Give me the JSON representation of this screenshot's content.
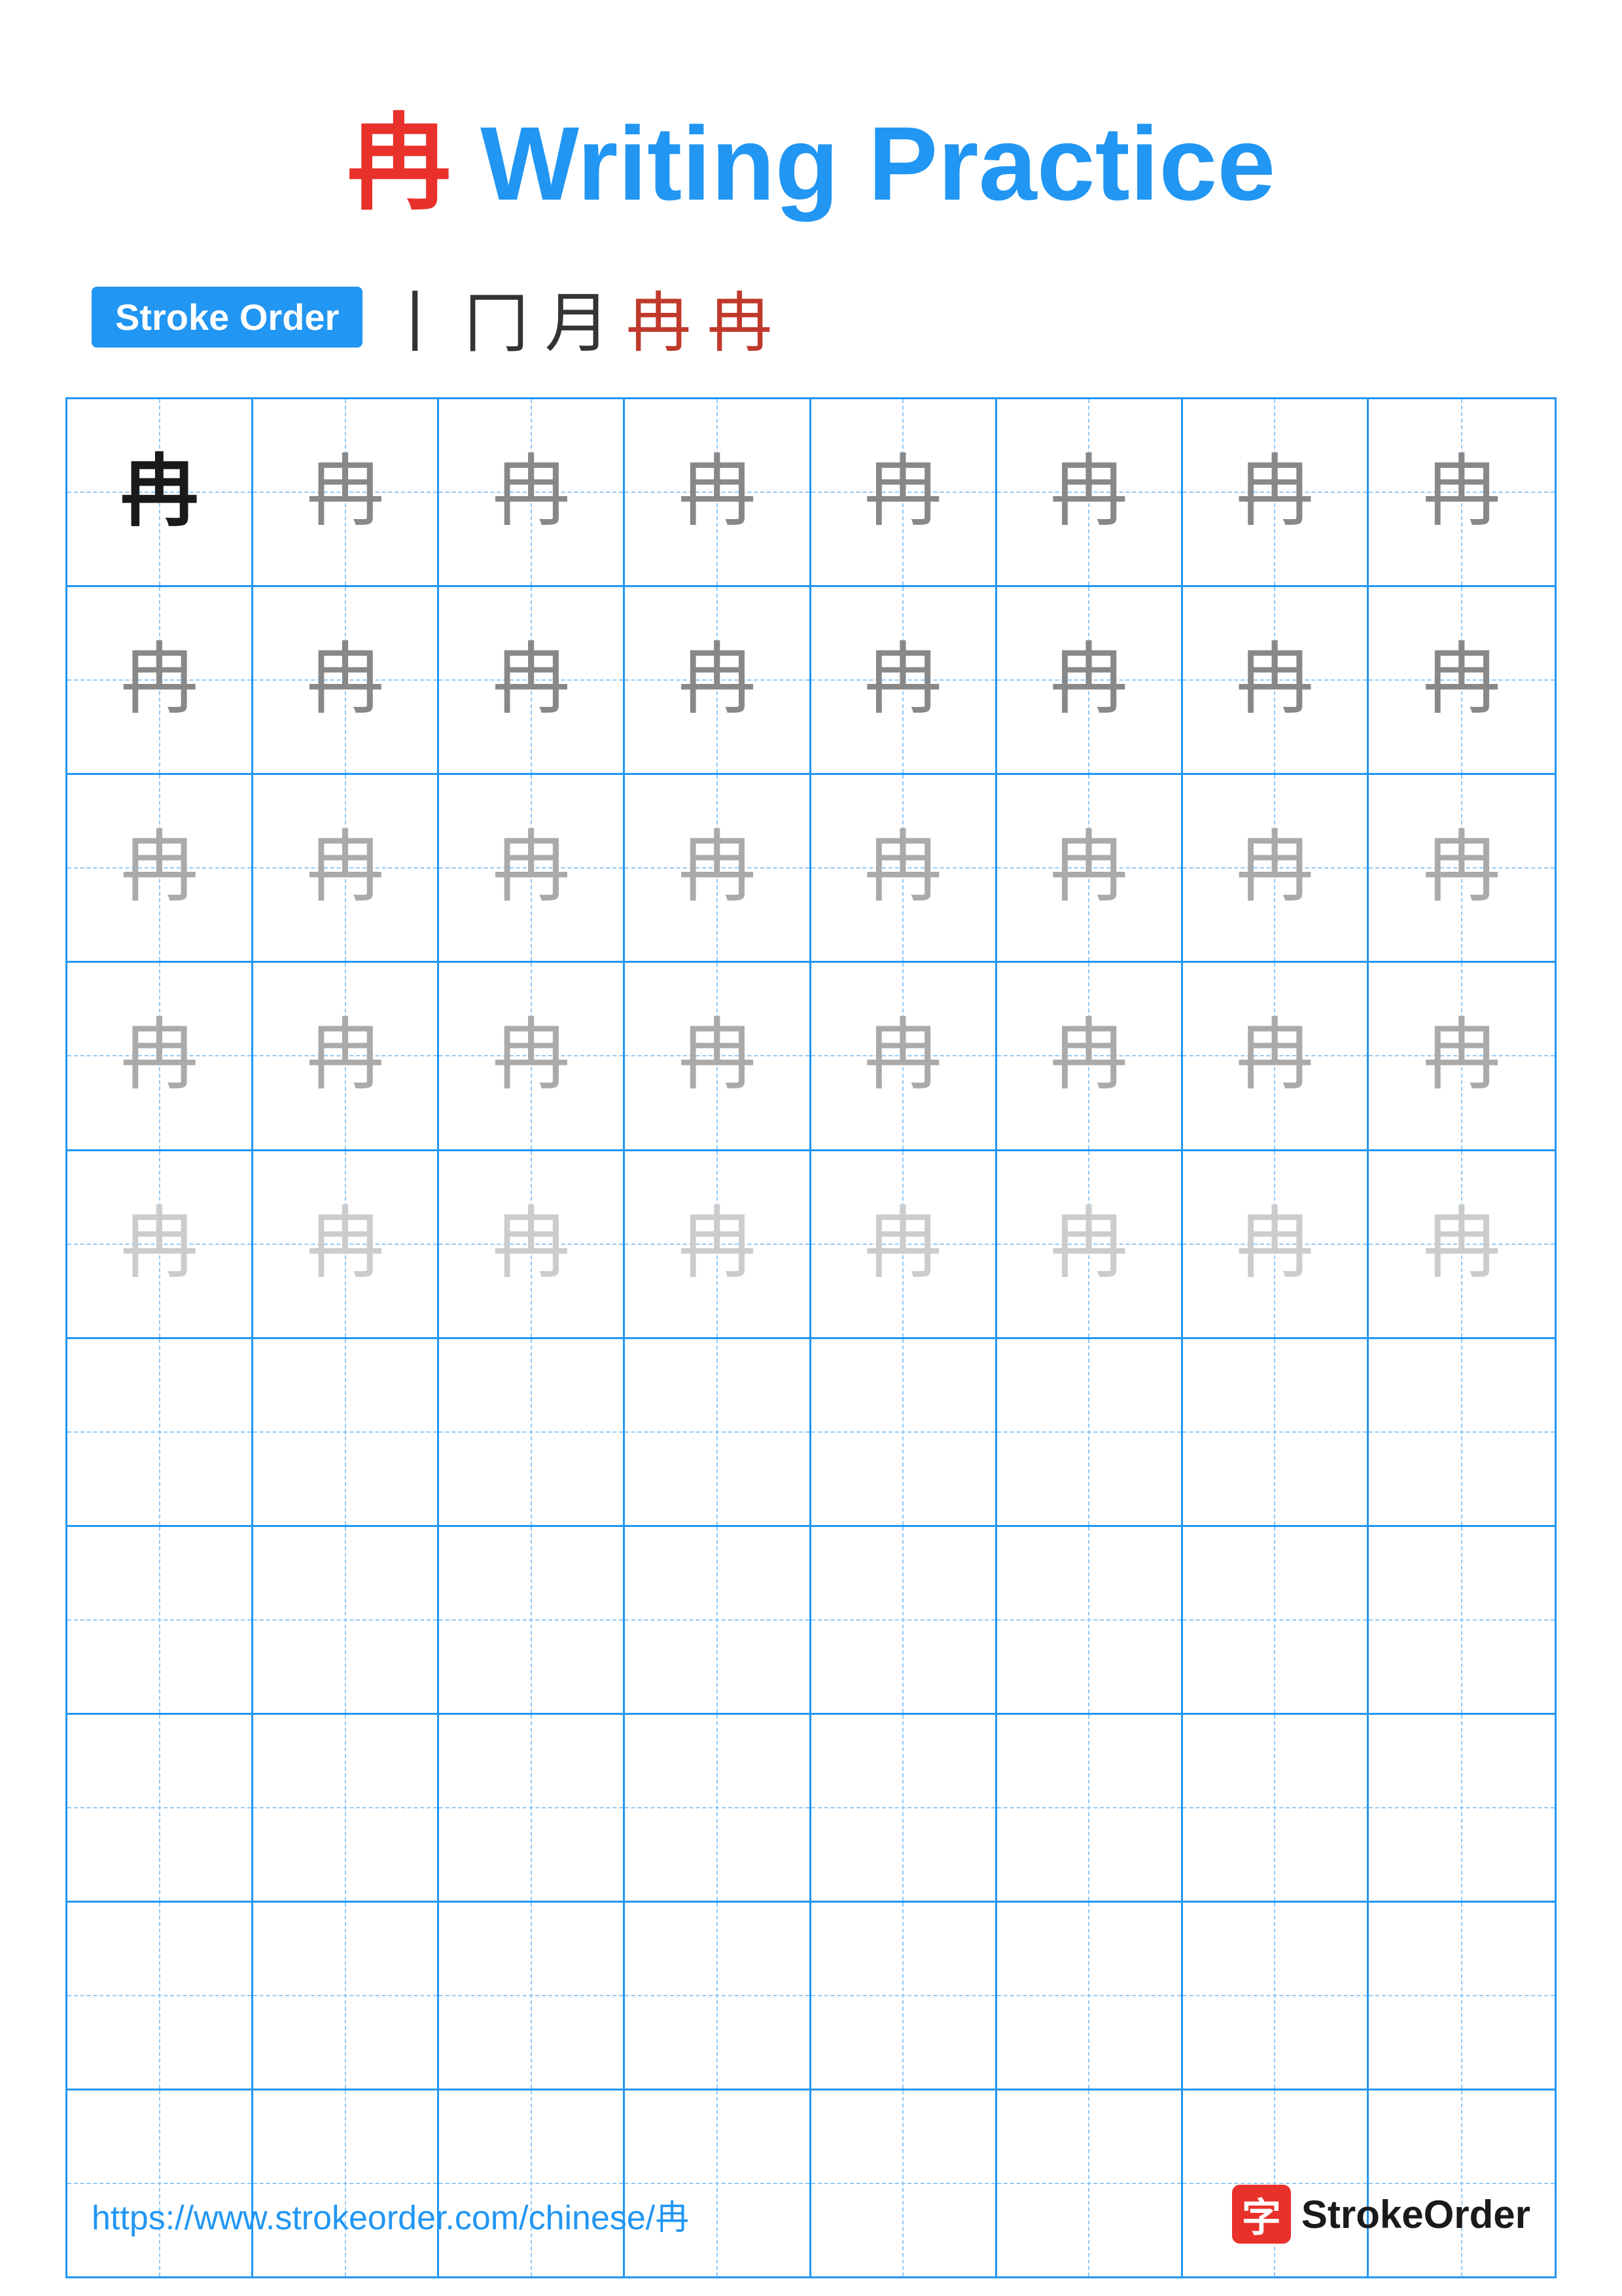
{
  "title": {
    "char": "冉",
    "text": " Writing Practice"
  },
  "stroke_order": {
    "badge_label": "Stroke Order",
    "sequence": [
      "丨",
      "冂",
      "月",
      "冉",
      "冉"
    ]
  },
  "grid": {
    "rows": 10,
    "cols": 8,
    "character": "冉",
    "row_configs": [
      {
        "chars": [
          "black",
          "dark",
          "dark",
          "dark",
          "dark",
          "dark",
          "dark",
          "dark"
        ]
      },
      {
        "chars": [
          "dark",
          "dark",
          "dark",
          "dark",
          "dark",
          "dark",
          "dark",
          "dark"
        ]
      },
      {
        "chars": [
          "medium",
          "medium",
          "medium",
          "medium",
          "medium",
          "medium",
          "medium",
          "medium"
        ]
      },
      {
        "chars": [
          "medium",
          "medium",
          "medium",
          "medium",
          "medium",
          "medium",
          "medium",
          "medium"
        ]
      },
      {
        "chars": [
          "light",
          "light",
          "light",
          "light",
          "light",
          "light",
          "light",
          "light"
        ]
      },
      {
        "chars": [
          "empty",
          "empty",
          "empty",
          "empty",
          "empty",
          "empty",
          "empty",
          "empty"
        ]
      },
      {
        "chars": [
          "empty",
          "empty",
          "empty",
          "empty",
          "empty",
          "empty",
          "empty",
          "empty"
        ]
      },
      {
        "chars": [
          "empty",
          "empty",
          "empty",
          "empty",
          "empty",
          "empty",
          "empty",
          "empty"
        ]
      },
      {
        "chars": [
          "empty",
          "empty",
          "empty",
          "empty",
          "empty",
          "empty",
          "empty",
          "empty"
        ]
      },
      {
        "chars": [
          "empty",
          "empty",
          "empty",
          "empty",
          "empty",
          "empty",
          "empty",
          "empty"
        ]
      }
    ]
  },
  "footer": {
    "url": "https://www.strokeorder.com/chinese/冉",
    "logo_char": "字",
    "logo_text": "StrokeOrder"
  }
}
